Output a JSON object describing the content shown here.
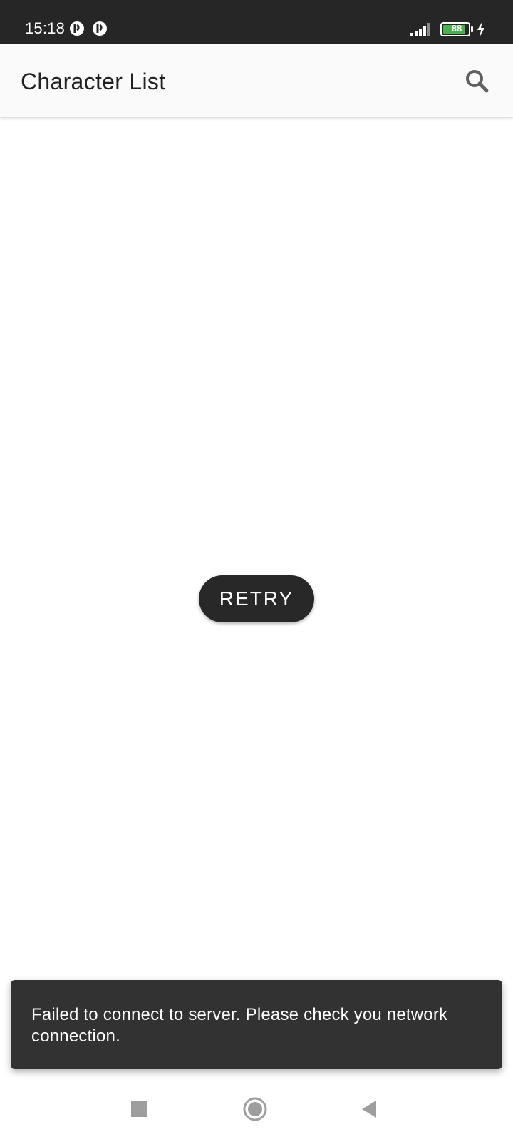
{
  "status_bar": {
    "time": "15:18",
    "battery_level": "88",
    "icons": [
      "app-notification-icon",
      "app-notification-icon",
      "signal-icon",
      "battery-icon",
      "charging-icon"
    ]
  },
  "app_bar": {
    "title": "Character List",
    "search_icon": "search-icon"
  },
  "main": {
    "retry_label": "RETRY"
  },
  "snackbar": {
    "message": "Failed to connect to server. Please check you network connection."
  },
  "nav_bar": {
    "icons": [
      "recents-icon",
      "home-icon",
      "back-icon"
    ]
  },
  "colors": {
    "status_bar_bg": "#262626",
    "app_bar_bg": "#fafafa",
    "button_bg": "#282828",
    "snackbar_bg": "#323232",
    "battery_fill": "#4caf50"
  }
}
